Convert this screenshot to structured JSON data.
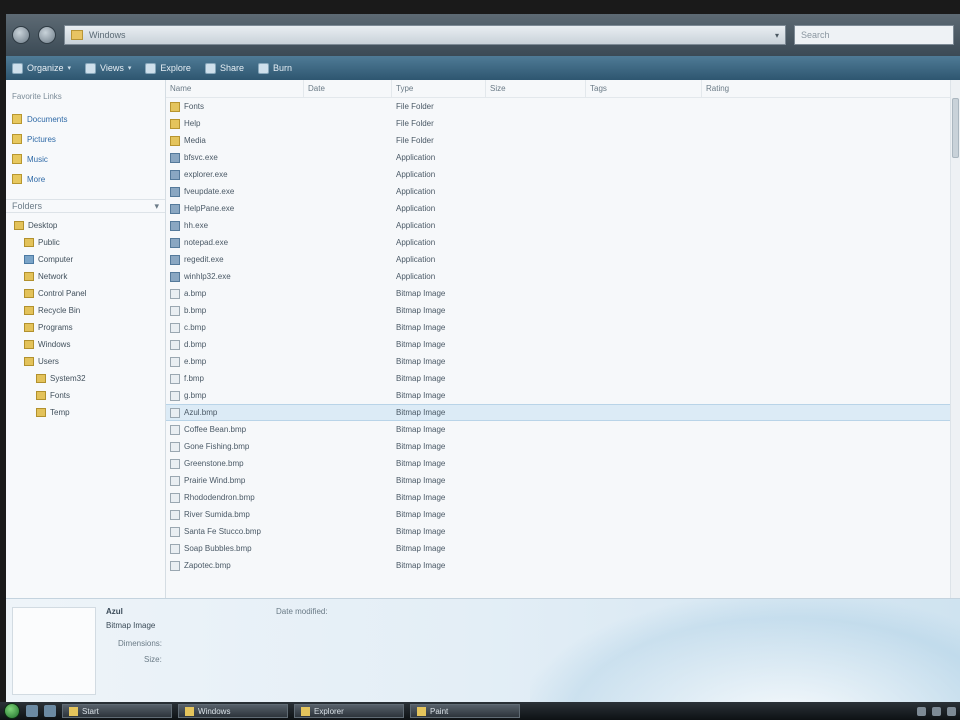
{
  "window": {
    "address": "Windows",
    "search_placeholder": "Search"
  },
  "toolbar": {
    "items": [
      "Organize",
      "Views",
      "Explore",
      "Share",
      "Burn"
    ]
  },
  "navpane": {
    "heading": "Favorite Links",
    "favorites": [
      "Documents",
      "Pictures",
      "Music",
      "More"
    ],
    "folders_label": "Folders",
    "tree": [
      "Desktop",
      "Public",
      "Computer",
      "Network",
      "Control Panel",
      "Recycle Bin",
      "Programs",
      "Windows",
      "Users",
      "System32",
      "Fonts",
      "Temp"
    ]
  },
  "columns": {
    "name": "Name",
    "date": "Date",
    "type": "Type",
    "size": "Size",
    "tags": "Tags",
    "rating": "Rating"
  },
  "files": [
    {
      "name": "Fonts",
      "date": "",
      "type": "File Folder",
      "size": "",
      "tags": "",
      "rating": "",
      "icon": "folder"
    },
    {
      "name": "Help",
      "date": "",
      "type": "File Folder",
      "size": "",
      "tags": "",
      "rating": "",
      "icon": "folder"
    },
    {
      "name": "Media",
      "date": "",
      "type": "File Folder",
      "size": "",
      "tags": "",
      "rating": "",
      "icon": "folder"
    },
    {
      "name": "bfsvc.exe",
      "date": "",
      "type": "Application",
      "size": "",
      "tags": "",
      "rating": "",
      "icon": "app"
    },
    {
      "name": "explorer.exe",
      "date": "",
      "type": "Application",
      "size": "",
      "tags": "",
      "rating": "",
      "icon": "app"
    },
    {
      "name": "fveupdate.exe",
      "date": "",
      "type": "Application",
      "size": "",
      "tags": "",
      "rating": "",
      "icon": "app"
    },
    {
      "name": "HelpPane.exe",
      "date": "",
      "type": "Application",
      "size": "",
      "tags": "",
      "rating": "",
      "icon": "app"
    },
    {
      "name": "hh.exe",
      "date": "",
      "type": "Application",
      "size": "",
      "tags": "",
      "rating": "",
      "icon": "app"
    },
    {
      "name": "notepad.exe",
      "date": "",
      "type": "Application",
      "size": "",
      "tags": "",
      "rating": "",
      "icon": "app"
    },
    {
      "name": "regedit.exe",
      "date": "",
      "type": "Application",
      "size": "",
      "tags": "",
      "rating": "",
      "icon": "app"
    },
    {
      "name": "winhlp32.exe",
      "date": "",
      "type": "Application",
      "size": "",
      "tags": "",
      "rating": "",
      "icon": "app"
    },
    {
      "name": "a.bmp",
      "date": "",
      "type": "Bitmap Image",
      "size": "",
      "tags": "",
      "rating": "",
      "icon": "file"
    },
    {
      "name": "b.bmp",
      "date": "",
      "type": "Bitmap Image",
      "size": "",
      "tags": "",
      "rating": "",
      "icon": "file"
    },
    {
      "name": "c.bmp",
      "date": "",
      "type": "Bitmap Image",
      "size": "",
      "tags": "",
      "rating": "",
      "icon": "file"
    },
    {
      "name": "d.bmp",
      "date": "",
      "type": "Bitmap Image",
      "size": "",
      "tags": "",
      "rating": "",
      "icon": "file"
    },
    {
      "name": "e.bmp",
      "date": "",
      "type": "Bitmap Image",
      "size": "",
      "tags": "",
      "rating": "",
      "icon": "file"
    },
    {
      "name": "f.bmp",
      "date": "",
      "type": "Bitmap Image",
      "size": "",
      "tags": "",
      "rating": "",
      "icon": "file"
    },
    {
      "name": "g.bmp",
      "date": "",
      "type": "Bitmap Image",
      "size": "",
      "tags": "",
      "rating": "",
      "icon": "file"
    },
    {
      "name": "Azul.bmp",
      "date": "",
      "type": "Bitmap Image",
      "size": "",
      "tags": "",
      "rating": "",
      "icon": "file",
      "selected": true
    },
    {
      "name": "Coffee Bean.bmp",
      "date": "",
      "type": "Bitmap Image",
      "size": "",
      "tags": "",
      "rating": "",
      "icon": "file"
    },
    {
      "name": "Gone Fishing.bmp",
      "date": "",
      "type": "Bitmap Image",
      "size": "",
      "tags": "",
      "rating": "",
      "icon": "file"
    },
    {
      "name": "Greenstone.bmp",
      "date": "",
      "type": "Bitmap Image",
      "size": "",
      "tags": "",
      "rating": "",
      "icon": "file"
    },
    {
      "name": "Prairie Wind.bmp",
      "date": "",
      "type": "Bitmap Image",
      "size": "",
      "tags": "",
      "rating": "",
      "icon": "file"
    },
    {
      "name": "Rhododendron.bmp",
      "date": "",
      "type": "Bitmap Image",
      "size": "",
      "tags": "",
      "rating": "",
      "icon": "file"
    },
    {
      "name": "River Sumida.bmp",
      "date": "",
      "type": "Bitmap Image",
      "size": "",
      "tags": "",
      "rating": "",
      "icon": "file"
    },
    {
      "name": "Santa Fe Stucco.bmp",
      "date": "",
      "type": "Bitmap Image",
      "size": "",
      "tags": "",
      "rating": "",
      "icon": "file"
    },
    {
      "name": "Soap Bubbles.bmp",
      "date": "",
      "type": "Bitmap Image",
      "size": "",
      "tags": "",
      "rating": "",
      "icon": "file"
    },
    {
      "name": "Zapotec.bmp",
      "date": "",
      "type": "Bitmap Image",
      "size": "",
      "tags": "",
      "rating": "",
      "icon": "file"
    }
  ],
  "details": {
    "filename": "Azul",
    "type": "Bitmap Image",
    "date_label": "Date modified:",
    "dimensions_label": "Dimensions:",
    "dimensions": "",
    "size_label": "Size:",
    "size": "",
    "date_created": ""
  },
  "taskbar": {
    "buttons": [
      "Start",
      "Windows",
      "Explorer",
      "Paint"
    ]
  }
}
